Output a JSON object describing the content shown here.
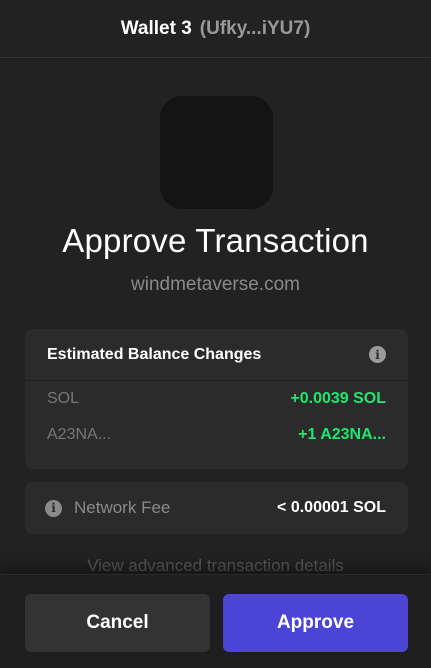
{
  "header": {
    "wallet_name": "Wallet 3",
    "wallet_address": "(Ufky...iYU7)"
  },
  "request": {
    "title": "Approve Transaction",
    "origin": "windmetaverse.com"
  },
  "balance_changes": {
    "heading": "Estimated Balance Changes",
    "rows": [
      {
        "asset": "SOL",
        "change": "+0.0039 SOL"
      },
      {
        "asset": "A23NA...",
        "change": "+1 A23NA..."
      }
    ]
  },
  "network_fee": {
    "label": "Network Fee",
    "value": "< 0.00001 SOL"
  },
  "advanced_link": "View advanced transaction details",
  "actions": {
    "cancel": "Cancel",
    "approve": "Approve"
  },
  "colors": {
    "background": "#222222",
    "positive_change": "#21e56f",
    "approve_button": "#4c44d4",
    "cancel_button": "#333333"
  },
  "icons": {
    "info": "info-icon"
  }
}
